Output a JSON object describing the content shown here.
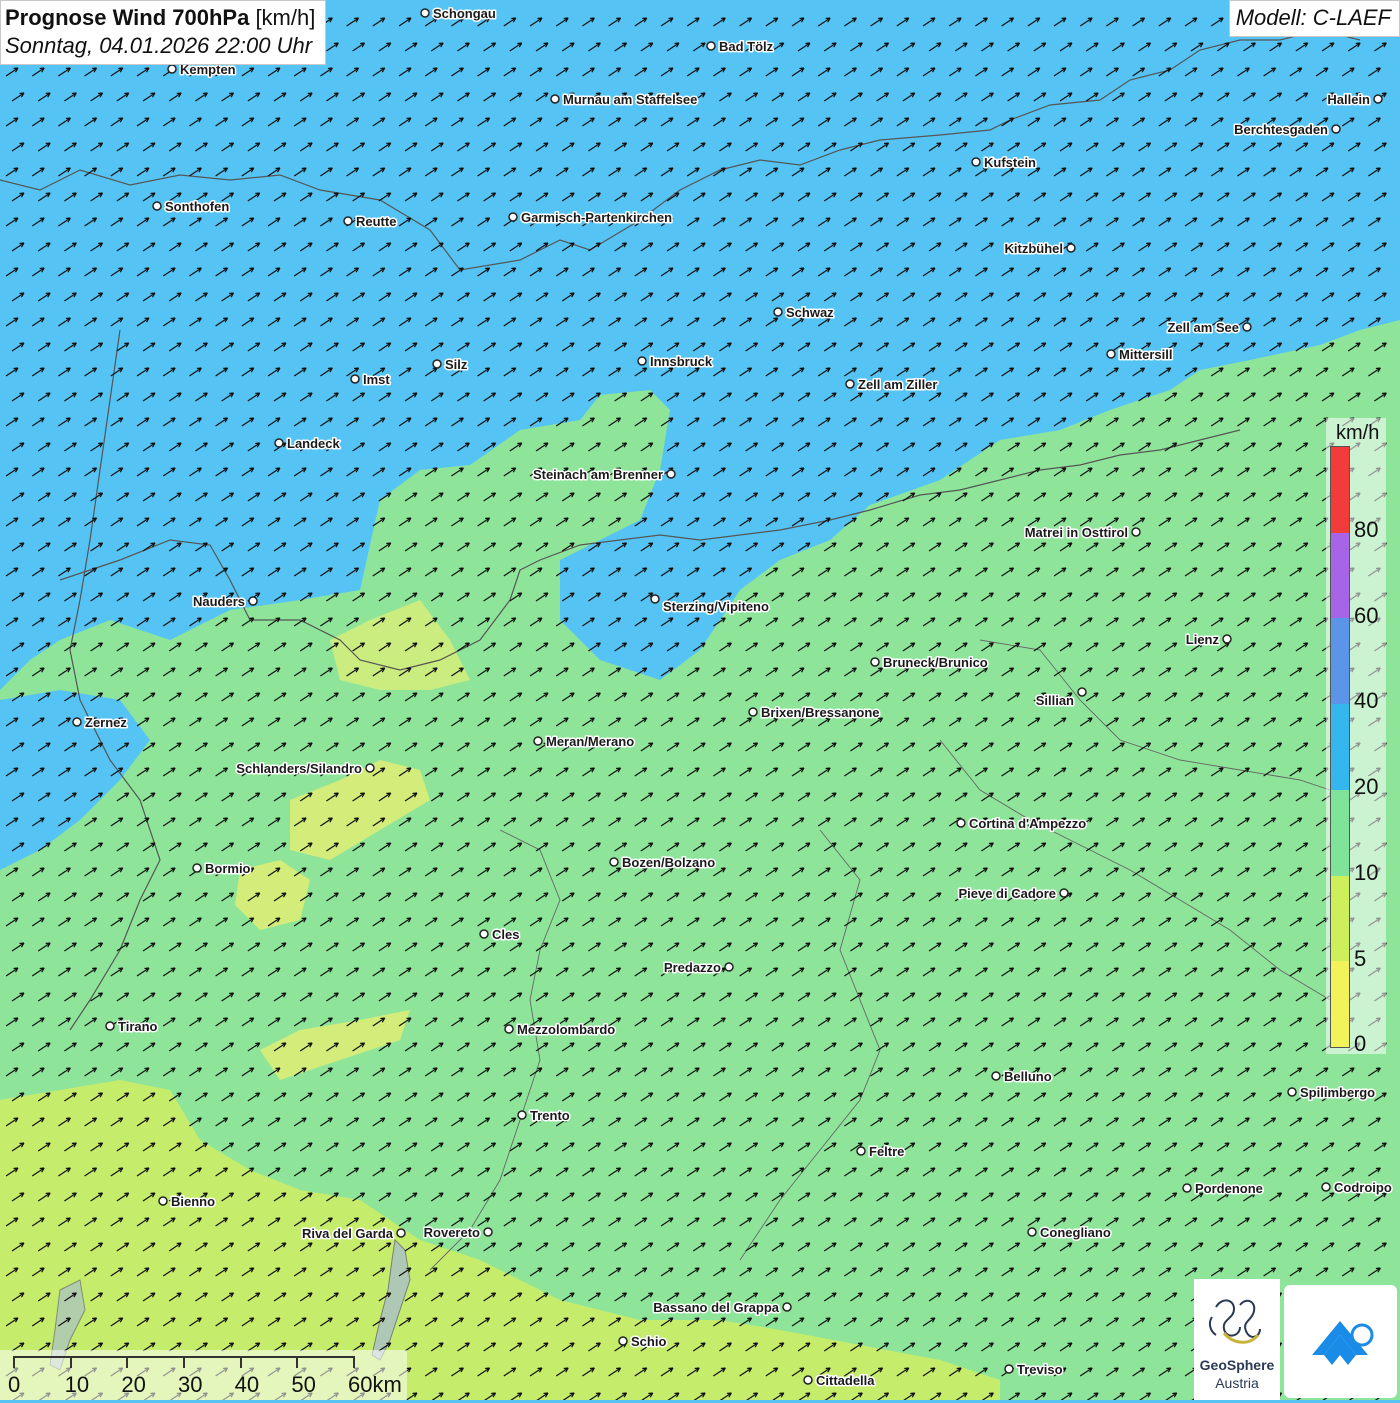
{
  "title": {
    "bold": "Prognose Wind 700hPa",
    "unit": "[km/h]",
    "datetime": "Sonntag, 04.01.2026 22:00 Uhr"
  },
  "model": "Modell: C-LAEF",
  "legend": {
    "unit": "km/h",
    "ticks": [
      "80",
      "60",
      "40",
      "20",
      "10",
      "5",
      "0"
    ],
    "colors": [
      "#f23b3b",
      "#a864e6",
      "#5a95ea",
      "#34b6ee",
      "#7fe39a",
      "#cdef5a",
      "#f2f25a"
    ]
  },
  "scalebar": {
    "labels": [
      "0",
      "10",
      "20",
      "30",
      "40",
      "50",
      "60km"
    ]
  },
  "logos": {
    "geosphere_line1": "GeoSphere",
    "geosphere_line2": "Austria"
  },
  "colors": {
    "blue_zone": "#55c4f4",
    "green_zone": "#8ee59a",
    "yellow_green_zone": "#c6ec6c",
    "yellow_zone": "#e6ef72",
    "border": "#555555",
    "arrow": "#111111"
  },
  "cities": [
    {
      "name": "Schongau"
    },
    {
      "name": "Bad Tölz"
    },
    {
      "name": "Kempten"
    },
    {
      "name": "Murnau am Staffelsee"
    },
    {
      "name": "Hallein"
    },
    {
      "name": "Berchtesgaden"
    },
    {
      "name": "Kufstein"
    },
    {
      "name": "Sonthofen"
    },
    {
      "name": "Reutte"
    },
    {
      "name": "Garmisch-Partenkirchen"
    },
    {
      "name": "Kitzbühel"
    },
    {
      "name": "Schwaz"
    },
    {
      "name": "Zell am See"
    },
    {
      "name": "Mittersill"
    },
    {
      "name": "Innsbruck"
    },
    {
      "name": "Silz"
    },
    {
      "name": "Imst"
    },
    {
      "name": "Zell am Ziller"
    },
    {
      "name": "Landeck"
    },
    {
      "name": "Steinach am Brenner"
    },
    {
      "name": "Matrei in Osttirol"
    },
    {
      "name": "Nauders"
    },
    {
      "name": "Sterzing/Vipiteno"
    },
    {
      "name": "Lienz"
    },
    {
      "name": "Bruneck/Brunico"
    },
    {
      "name": "Sillian"
    },
    {
      "name": "Zernez"
    },
    {
      "name": "Brixen/Bressanone"
    },
    {
      "name": "Meran/Merano"
    },
    {
      "name": "Schlanders/Silandro"
    },
    {
      "name": "Cortina d'Ampezzo"
    },
    {
      "name": "Bozen/Bolzano"
    },
    {
      "name": "Bormio"
    },
    {
      "name": "Pieve di Cadore"
    },
    {
      "name": "Cles"
    },
    {
      "name": "Predazzo"
    },
    {
      "name": "Tirano"
    },
    {
      "name": "Mezzolombardo"
    },
    {
      "name": "Belluno"
    },
    {
      "name": "Spilimbergo"
    },
    {
      "name": "Trento"
    },
    {
      "name": "Feltre"
    },
    {
      "name": "Pordenone"
    },
    {
      "name": "Codroipo"
    },
    {
      "name": "Bienno"
    },
    {
      "name": "Riva del Garda"
    },
    {
      "name": "Rovereto"
    },
    {
      "name": "Conegliano"
    },
    {
      "name": "Bassano del Grappa"
    },
    {
      "name": "Schio"
    },
    {
      "name": "Treviso"
    },
    {
      "name": "Cittadella"
    }
  ]
}
